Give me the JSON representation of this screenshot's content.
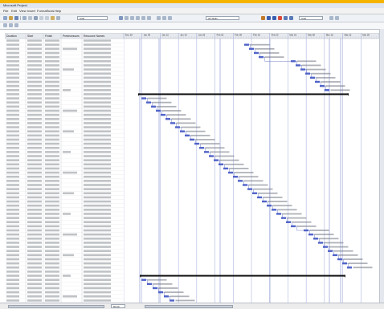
{
  "window": {
    "title": "Microsoft Project"
  },
  "menu": [
    "File",
    "Edit",
    "View",
    "Insert",
    "Format",
    "Tools",
    "Help"
  ],
  "toolbar": {
    "font": "Arial",
    "size": "8",
    "zoom": "All Tasks",
    "filter": "Arial"
  },
  "grid": {
    "columns": [
      "Duration",
      "Start",
      "Finish",
      "Predecessors",
      "Resource Names"
    ],
    "row_count": 64
  },
  "gantt": {
    "timescale_top": [
      "Dec 29",
      "Jan 05",
      "Jan 12",
      "Jan 19",
      "Jan 26",
      "Feb 02",
      "Feb 09",
      "Feb 16",
      "Feb 23",
      "Mar 01",
      "Mar 08",
      "Mar 15",
      "Mar 22",
      "Mar 29"
    ],
    "bar_color": "#5063c8",
    "summary_color": "#111111"
  },
  "status": {
    "zoom_box": "50.00"
  }
}
